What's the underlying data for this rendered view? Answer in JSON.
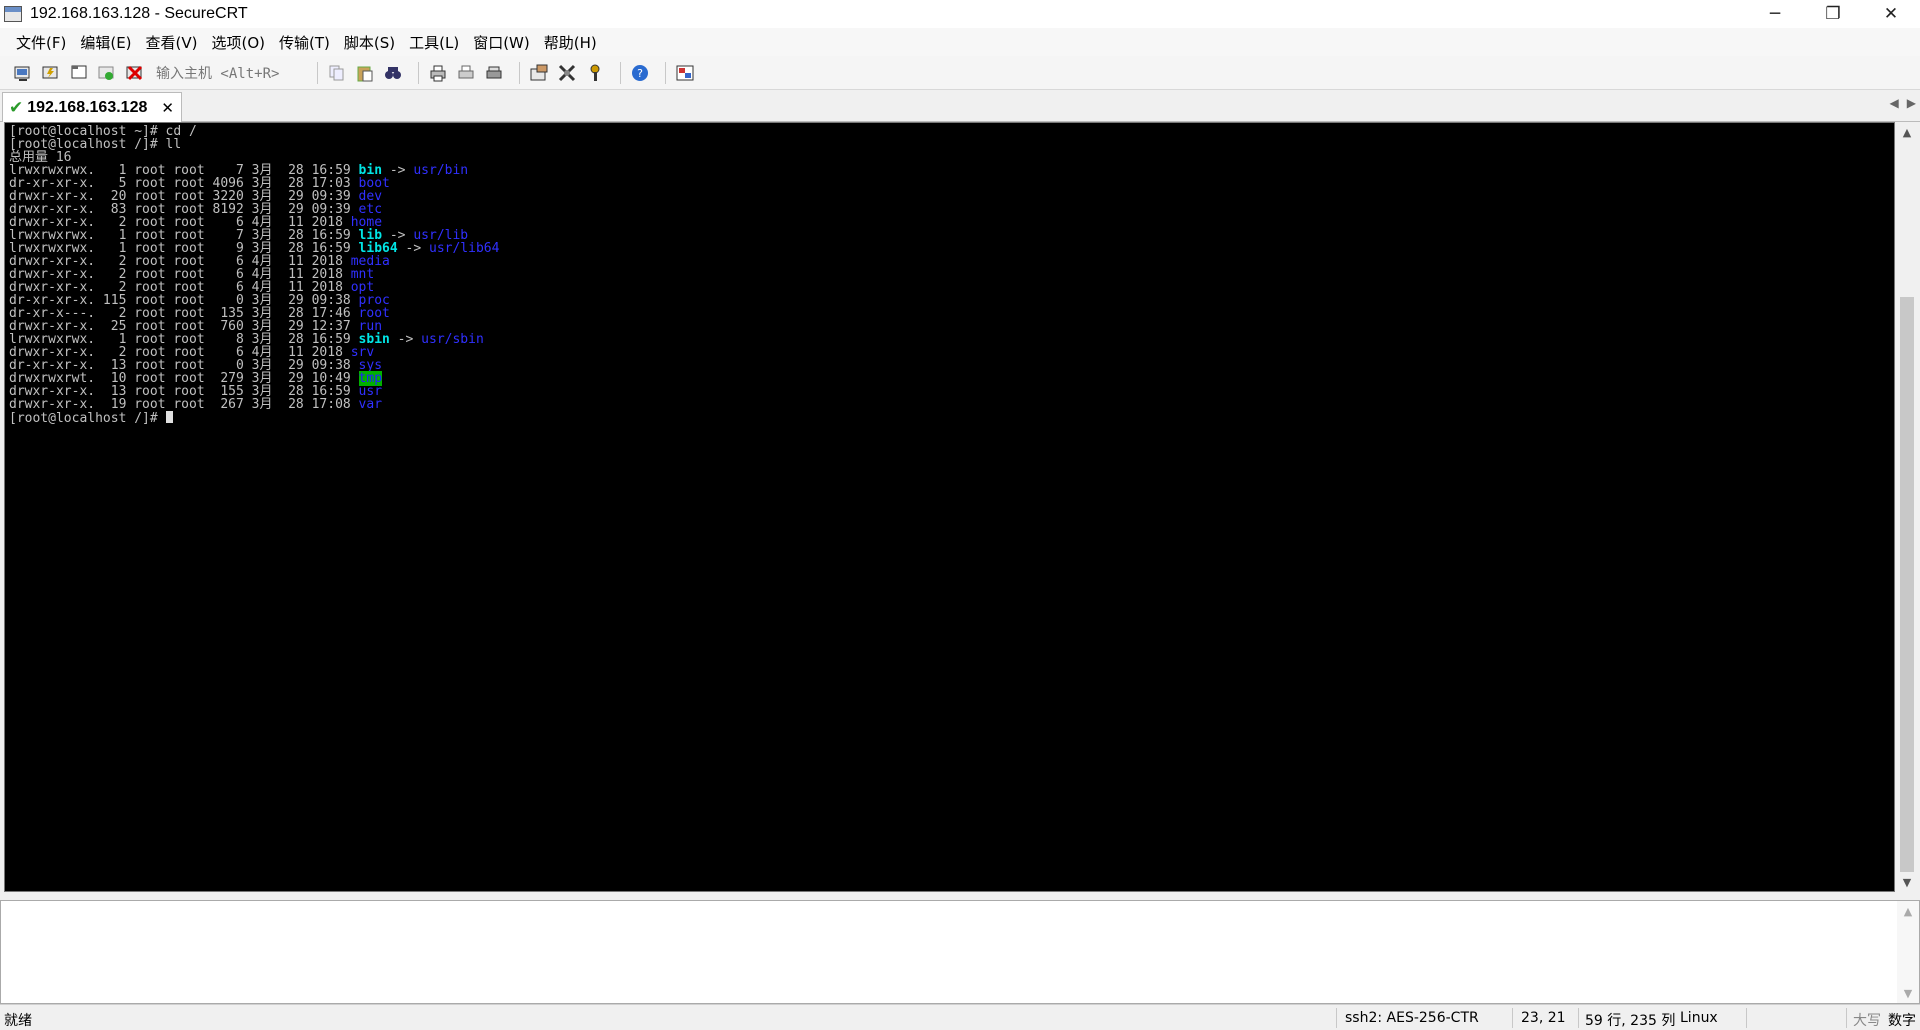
{
  "window": {
    "title": "192.168.163.128 - SecureCRT"
  },
  "window_buttons": {
    "minimize": "─",
    "restore": "❐",
    "close": "✕"
  },
  "menu": [
    "文件(F)",
    "编辑(E)",
    "查看(V)",
    "选项(O)",
    "传输(T)",
    "脚本(S)",
    "工具(L)",
    "窗口(W)",
    "帮助(H)"
  ],
  "toolbar": {
    "quick_connect_placeholder": "输入主机 <Alt+R>",
    "icons": [
      "connect-icon",
      "quick-connect-icon",
      "connect-tab-icon",
      "reconnect-icon",
      "disconnect-icon",
      "copy-icon",
      "paste-icon",
      "find-icon",
      "print-icon",
      "print-setup-icon",
      "print-screen-icon",
      "session-options-icon",
      "global-options-icon",
      "keymap-icon",
      "help-icon",
      "sftp-icon"
    ]
  },
  "tab": {
    "label": "192.168.163.128",
    "check": "✔",
    "close": "✕"
  },
  "terminal": {
    "lines": [
      [
        {
          "t": "[root@localhost ~]# cd /"
        }
      ],
      [
        {
          "t": "[root@localhost /]# ll"
        }
      ],
      [
        {
          "t": "总用量 16"
        }
      ],
      [
        {
          "t": "lrwxrwxrwx.   1 root root    7 3月  28 16:59 "
        },
        {
          "t": "bin",
          "c": "cyan"
        },
        {
          "t": " -> "
        },
        {
          "t": "usr/bin",
          "c": "blue"
        }
      ],
      [
        {
          "t": "dr-xr-xr-x.   5 root root 4096 3月  28 17:03 "
        },
        {
          "t": "boot",
          "c": "blue"
        }
      ],
      [
        {
          "t": "drwxr-xr-x.  20 root root 3220 3月  29 09:39 "
        },
        {
          "t": "dev",
          "c": "blue"
        }
      ],
      [
        {
          "t": "drwxr-xr-x.  83 root root 8192 3月  29 09:39 "
        },
        {
          "t": "etc",
          "c": "blue"
        }
      ],
      [
        {
          "t": "drwxr-xr-x.   2 root root    6 4月  11 2018 "
        },
        {
          "t": "home",
          "c": "blue"
        }
      ],
      [
        {
          "t": "lrwxrwxrwx.   1 root root    7 3月  28 16:59 "
        },
        {
          "t": "lib",
          "c": "cyan"
        },
        {
          "t": " -> "
        },
        {
          "t": "usr/lib",
          "c": "blue"
        }
      ],
      [
        {
          "t": "lrwxrwxrwx.   1 root root    9 3月  28 16:59 "
        },
        {
          "t": "lib64",
          "c": "cyan"
        },
        {
          "t": " -> "
        },
        {
          "t": "usr/lib64",
          "c": "blue"
        }
      ],
      [
        {
          "t": "drwxr-xr-x.   2 root root    6 4月  11 2018 "
        },
        {
          "t": "media",
          "c": "blue"
        }
      ],
      [
        {
          "t": "drwxr-xr-x.   2 root root    6 4月  11 2018 "
        },
        {
          "t": "mnt",
          "c": "blue"
        }
      ],
      [
        {
          "t": "drwxr-xr-x.   2 root root    6 4月  11 2018 "
        },
        {
          "t": "opt",
          "c": "blue"
        }
      ],
      [
        {
          "t": "dr-xr-xr-x. 115 root root    0 3月  29 09:38 "
        },
        {
          "t": "proc",
          "c": "blue"
        }
      ],
      [
        {
          "t": "dr-xr-x---.   2 root root  135 3月  28 17:46 "
        },
        {
          "t": "root",
          "c": "blue"
        }
      ],
      [
        {
          "t": "drwxr-xr-x.  25 root root  760 3月  29 12:37 "
        },
        {
          "t": "run",
          "c": "blue"
        }
      ],
      [
        {
          "t": "lrwxrwxrwx.   1 root root    8 3月  28 16:59 "
        },
        {
          "t": "sbin",
          "c": "cyan"
        },
        {
          "t": " -> "
        },
        {
          "t": "usr/sbin",
          "c": "blue"
        }
      ],
      [
        {
          "t": "drwxr-xr-x.   2 root root    6 4月  11 2018 "
        },
        {
          "t": "srv",
          "c": "blue"
        }
      ],
      [
        {
          "t": "dr-xr-xr-x.  13 root root    0 3月  29 09:38 "
        },
        {
          "t": "sys",
          "c": "blue"
        }
      ],
      [
        {
          "t": "drwxrwxrwt.  10 root root  279 3月  29 10:49 "
        },
        {
          "t": "tmp",
          "c": "tmp"
        }
      ],
      [
        {
          "t": "drwxr-xr-x.  13 root root  155 3月  28 16:59 "
        },
        {
          "t": "usr",
          "c": "blue"
        }
      ],
      [
        {
          "t": "drwxr-xr-x.  19 root root  267 3月  28 17:08 "
        },
        {
          "t": "var",
          "c": "blue"
        }
      ],
      [
        {
          "t": "[root@localhost /]# "
        },
        {
          "cursor": true
        }
      ]
    ]
  },
  "scrollbar": {
    "up": "▲",
    "down": "▼",
    "left": "◀",
    "right": "▶"
  },
  "status": {
    "ready": "就绪",
    "encryption": "ssh2: AES-256-CTR",
    "cursor_pos": "23,  21",
    "size": "59 行, 235 列",
    "os": "Linux",
    "caps": "大写",
    "num": "数字"
  }
}
